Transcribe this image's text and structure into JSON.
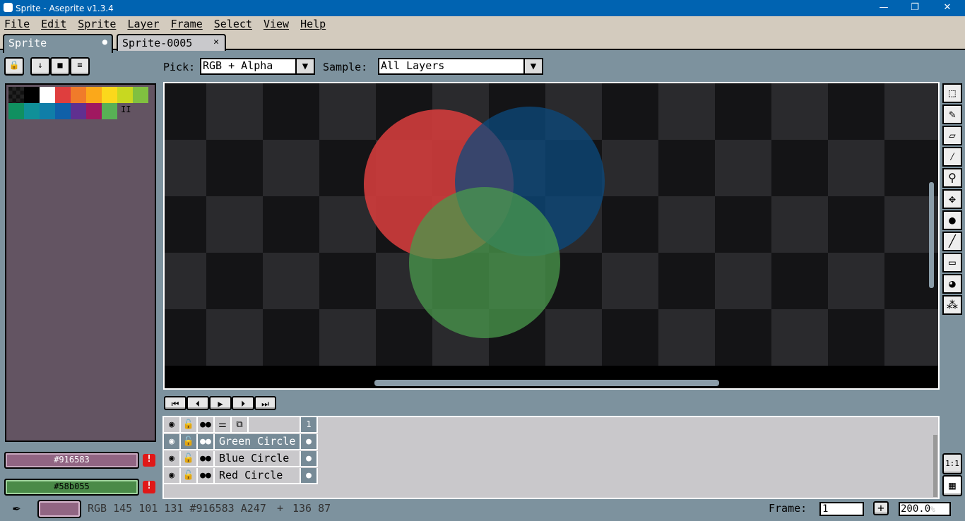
{
  "window": {
    "title": "Sprite - Aseprite v1.3.4",
    "minimize": "—",
    "maximize": "❐",
    "close": "✕"
  },
  "menu": [
    "File",
    "Edit",
    "Sprite",
    "Layer",
    "Frame",
    "Select",
    "View",
    "Help"
  ],
  "tabs": [
    {
      "label": "Sprite",
      "active": true,
      "marker": "●"
    },
    {
      "label": "Sprite-0005",
      "close": "✕"
    }
  ],
  "toolbar": {
    "pick_label": "Pick:",
    "pick_value": "RGB + Alpha",
    "sample_label": "Sample:",
    "sample_value": "All Layers",
    "dropdown_arrow": "▼"
  },
  "palette_buttons": [
    "🔒",
    "↓",
    "■",
    "≡"
  ],
  "palette": {
    "colors": [
      "#000000",
      "#ffffff",
      "#df3e3e",
      "#f07b2a",
      "#fba81a",
      "#fbd81c",
      "#c8d820",
      "#80c040",
      "#109060",
      "#109098",
      "#107ea8",
      "#1060a8",
      "#603090",
      "#a01860",
      "#58b055"
    ],
    "drag_handle": "II"
  },
  "colors": {
    "foreground": "#916583",
    "background": "#58b055",
    "warning": "!"
  },
  "timeline_buttons": [
    "⏮",
    "⏴",
    "▶",
    "⏵",
    "⏭"
  ],
  "layers": {
    "header_frame": "1",
    "items": [
      {
        "name": "Green Circle",
        "selected": true
      },
      {
        "name": "Blue Circle"
      },
      {
        "name": "Red Circle"
      }
    ]
  },
  "status": {
    "info": "RGB 145 101 131 #916583 A247",
    "coords": "136 87",
    "frame_label": "Frame:",
    "frame_value": "1",
    "add": "+",
    "zoom": "200.0",
    "zoom_unit": "%"
  },
  "right_buttons": {
    "one_to_one": "1:1",
    "film": "▦"
  }
}
